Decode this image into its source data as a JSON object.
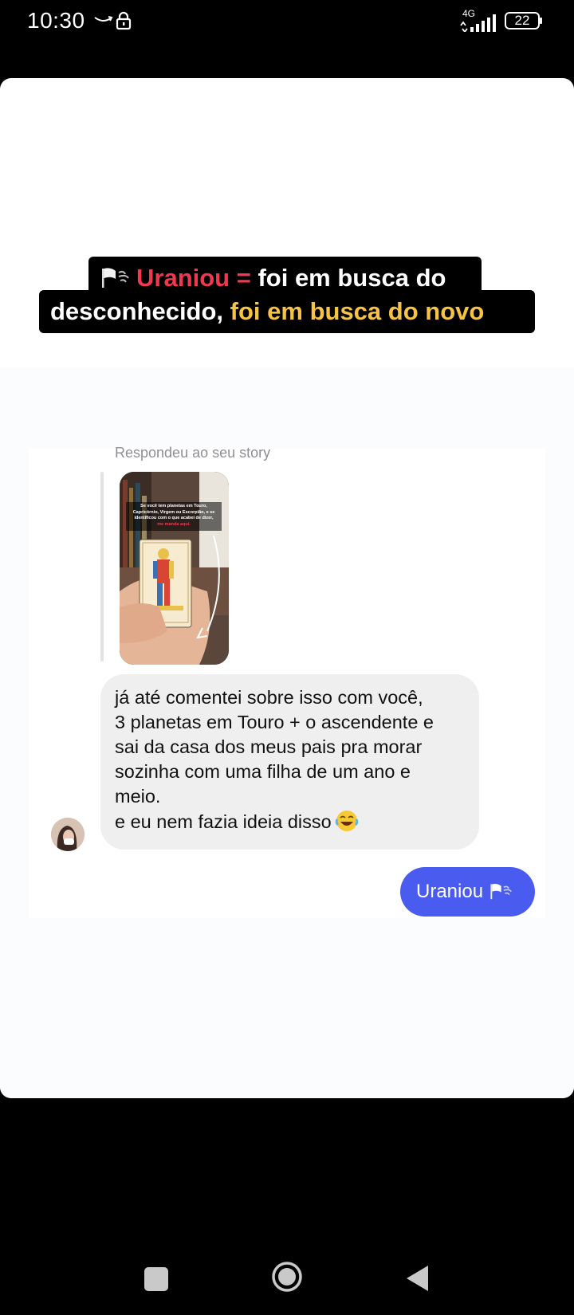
{
  "status_bar": {
    "time": "10:30",
    "network": "4G",
    "battery": "22"
  },
  "caption": {
    "line1_highlight": "Uraniou =",
    "line1_rest": " foi em busca do",
    "line2_plain": "desconhecido, ",
    "line2_highlight": "foi em busca do novo",
    "highlight_red": "#f0384f",
    "highlight_yellow": "#f6c344"
  },
  "chat": {
    "replied_label": "Respondeu ao seu story",
    "story_text_1": "Se você tem planetas em Touro,",
    "story_text_2": "Capricórnio, Virgem ou Escorpião, e se",
    "story_text_3": "identificou com o que acabei de dizer,",
    "story_text_4": "me manda aqui.",
    "incoming_lines": [
      "já até comentei sobre isso com você,",
      "3 planetas em Touro + o ascendente e",
      "sai da casa dos meus pais pra morar",
      "sozinha com uma filha de um ano e",
      "meio.",
      "e eu nem fazia ideia disso"
    ],
    "outgoing_text": "Uraniou",
    "outgoing_color": "#4a5cf0",
    "incoming_color": "#efefef"
  }
}
